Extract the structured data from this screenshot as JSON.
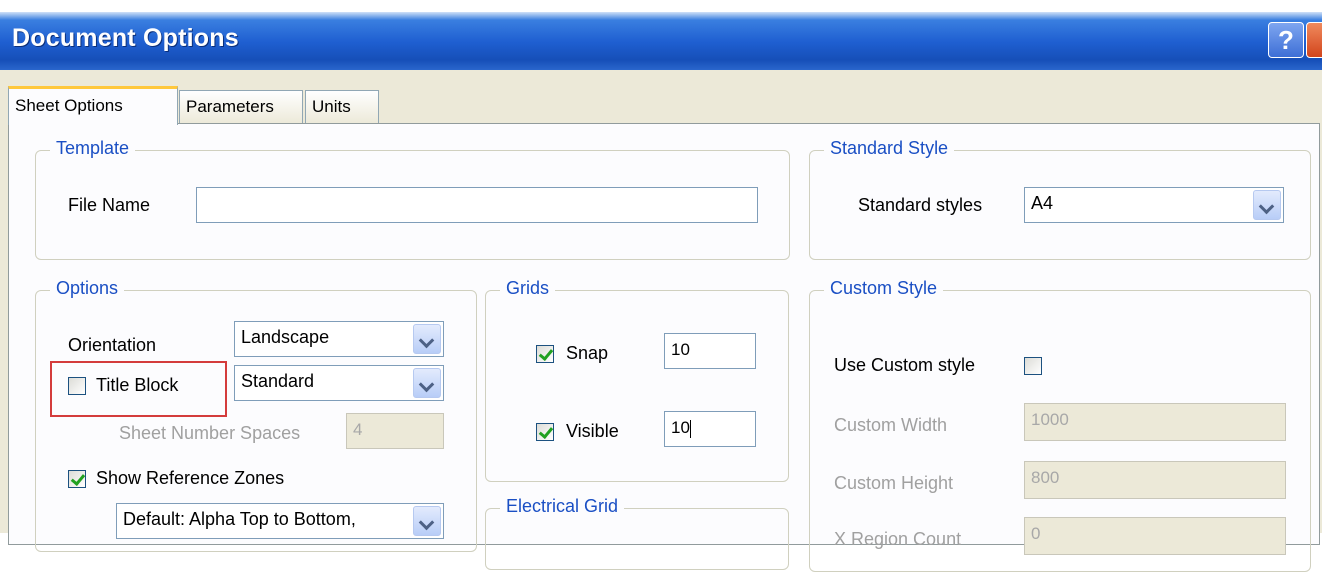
{
  "window": {
    "title": "Document Options",
    "help_label": "?"
  },
  "tabs": [
    {
      "label": "Sheet Options",
      "active": true
    },
    {
      "label": "Parameters",
      "active": false
    },
    {
      "label": "Units",
      "active": false
    }
  ],
  "template": {
    "legend": "Template",
    "file_name_label": "File Name",
    "file_name_value": ""
  },
  "standard_style": {
    "legend": "Standard Style",
    "label": "Standard styles",
    "value": "A4"
  },
  "options": {
    "legend": "Options",
    "orientation_label": "Orientation",
    "orientation_value": "Landscape",
    "title_block_label": "Title Block",
    "title_block_checked": false,
    "title_block_value": "Standard",
    "sheet_number_spaces_label": "Sheet Number Spaces",
    "sheet_number_spaces_value": "4",
    "show_reference_zones_label": "Show Reference Zones",
    "show_reference_zones_checked": true,
    "reference_zones_value": "Default: Alpha Top to Bottom,"
  },
  "grids": {
    "legend": "Grids",
    "snap_label": "Snap",
    "snap_checked": true,
    "snap_value": "10",
    "visible_label": "Visible",
    "visible_checked": true,
    "visible_value": "10"
  },
  "electrical_grid": {
    "legend": "Electrical Grid"
  },
  "custom_style": {
    "legend": "Custom Style",
    "use_custom_label": "Use Custom style",
    "use_custom_checked": false,
    "width_label": "Custom Width",
    "width_value": "1000",
    "height_label": "Custom Height",
    "height_value": "800",
    "x_region_label": "X Region Count",
    "x_region_value": "0"
  },
  "colors": {
    "titlebar": "#1f5fd1",
    "legend_text": "#1a4fc4",
    "highlight": "#d43c3c",
    "tab_accent": "#ffc83c"
  }
}
